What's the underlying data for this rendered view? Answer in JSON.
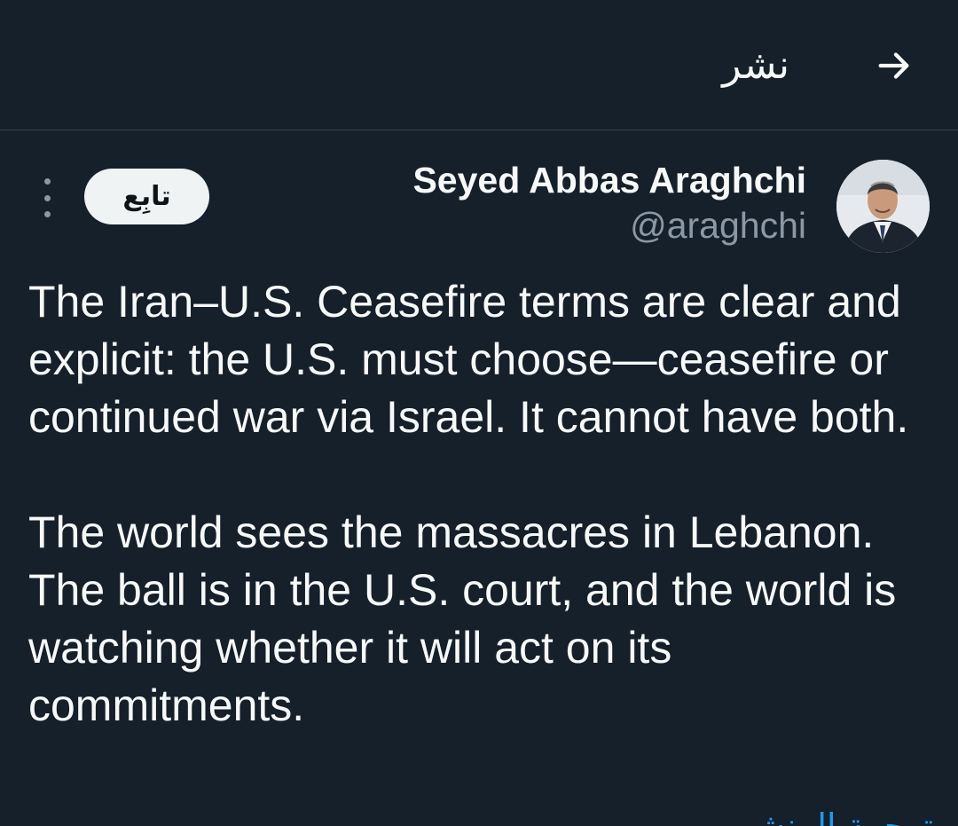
{
  "header": {
    "title": "نشر",
    "back_icon": "arrow-right-icon"
  },
  "author": {
    "display_name": "Seyed Abbas Araghchi",
    "handle": "@araghchi",
    "avatar_icon": "profile-photo",
    "follow_label": "تابِع",
    "more_icon": "vertical-dots-icon"
  },
  "tweet": {
    "paragraphs": [
      "The Iran–U.S. Ceasefire terms are clear and explicit: the U.S. must choose—ceasefire or continued war via Israel. It cannot have both.",
      "The world sees the massacres in Lebanon. The ball is in the U.S. court, and the world is watching whether it will act on its commitments."
    ],
    "translate_label": "ترجمة المنشور"
  },
  "colors": {
    "background": "#15202b",
    "text": "#f7f9f9",
    "secondary_text": "#8b98a5",
    "divider": "#38444d",
    "link": "#1d9bf0",
    "follow_button_bg": "#eff3f4"
  }
}
